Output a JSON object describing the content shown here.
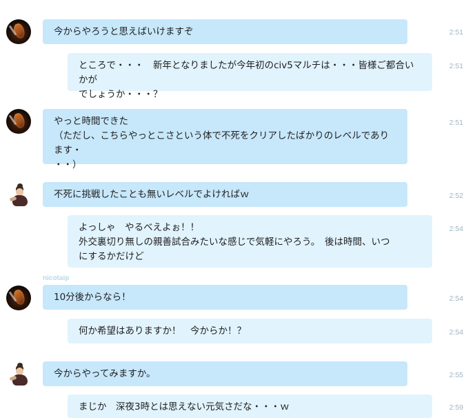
{
  "messages": [
    {
      "id": "m1",
      "avatar": "guitar-avatar",
      "text": "今からやろうと思えばいけますぞ",
      "time": "2:51",
      "style": "primary"
    },
    {
      "id": "m2",
      "avatar": null,
      "text": "ところで・・・　新年となりましたが今年初のciv5マルチは・・・皆様ご都合いかが\nでしょうか・・・？",
      "time": "2:51",
      "style": "cont"
    },
    {
      "id": "m3",
      "avatar": "guitar-avatar",
      "text": "やっと時間できた\n（ただし、こちらやっとこさという体で不死をクリアしたばかりのレベルであります・\n・・）",
      "time": "2:51",
      "style": "primary"
    },
    {
      "id": "m4",
      "avatar": "character-avatar",
      "text": "不死に挑戦したことも無いレベルでよければｗ",
      "time": "2:52",
      "style": "primary"
    },
    {
      "id": "m5",
      "avatar": null,
      "text": "よっしゃ　やるべえよぉ！！\n外交裏切り無しの親善試合みたいな感じで気軽にやろう。　後は時間、いつ\nにするかだけど",
      "time": "2:54",
      "style": "cont"
    },
    {
      "id": "m6",
      "avatar": "guitar-avatar",
      "text": "10分後からなら！",
      "time": "2:54",
      "style": "primary"
    },
    {
      "id": "m7",
      "avatar": null,
      "text": "何か希望はありますか！　今からか！？",
      "time": "2:54",
      "style": "cont"
    },
    {
      "id": "m8",
      "avatar": "character-avatar",
      "text": "今からやってみますか。",
      "time": "2:55",
      "style": "primary"
    },
    {
      "id": "m9",
      "avatar": null,
      "text": "まじか　深夜3時とは思えない元気さだな・・・ｗ",
      "time": "2:59",
      "style": "cont"
    }
  ],
  "faint_sender": "nicotaip",
  "colors": {
    "bubble_primary": "#c7e7fb",
    "bubble_cont": "#e1f3fd",
    "timestamp": "#9fb4c2"
  }
}
